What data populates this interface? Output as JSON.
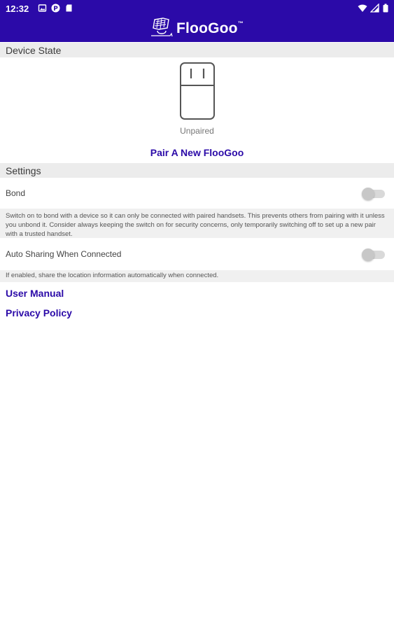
{
  "status_bar": {
    "time": "12:32",
    "left_icons": [
      "photo-icon",
      "p-badge-icon",
      "sd-card-icon"
    ],
    "right_icons": [
      "wifi-icon",
      "signal-icon",
      "battery-icon"
    ]
  },
  "app": {
    "brand_name": "FlooGoo",
    "brand_tm": "™",
    "brand_color": "#2b0aa8"
  },
  "device_state": {
    "header": "Device State",
    "status": "Unpaired",
    "pair_link": "Pair A New FlooGoo"
  },
  "settings": {
    "header": "Settings",
    "bond": {
      "label": "Bond",
      "enabled": false,
      "description": "Switch on to bond with a device so it can only be connected with paired handsets. This prevents others from pairing with it unless you unbond it. Consider always keeping the switch on for security concerns, only temporarily switching off to set up a new pair with a trusted handset."
    },
    "auto_sharing": {
      "label": "Auto Sharing When Connected",
      "enabled": false,
      "description": "If enabled, share the location information automatically when connected."
    }
  },
  "links": {
    "user_manual": "User Manual",
    "privacy_policy": "Privacy Policy"
  }
}
